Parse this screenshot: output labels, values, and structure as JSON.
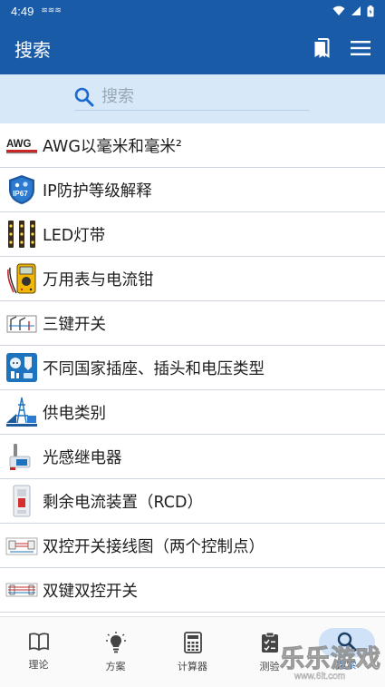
{
  "status_bar": {
    "time": "4:49",
    "notification": "≋≋≋"
  },
  "app_bar": {
    "title": "搜索",
    "bookmark_icon": "bookmark-icon",
    "menu_icon": "menu-icon"
  },
  "search": {
    "placeholder": "搜索",
    "value": "",
    "icon": "search-icon"
  },
  "list": {
    "items": [
      {
        "label": "AWG以毫米和毫米²",
        "icon": "awg-cable-icon"
      },
      {
        "label": "IP防护等级解释",
        "icon": "ip67-shield-icon"
      },
      {
        "label": "LED灯带",
        "icon": "led-strip-icon"
      },
      {
        "label": "万用表与电流钳",
        "icon": "multimeter-icon"
      },
      {
        "label": "三键开关",
        "icon": "three-way-switch-icon"
      },
      {
        "label": "不同国家插座、插头和电压类型",
        "icon": "plug-socket-icon"
      },
      {
        "label": "供电类别",
        "icon": "power-supply-icon"
      },
      {
        "label": "光感继电器",
        "icon": "light-sensor-relay-icon"
      },
      {
        "label": "剩余电流装置（RCD）",
        "icon": "rcd-device-icon"
      },
      {
        "label": "双控开关接线图（两个控制点）",
        "icon": "two-way-wiring-icon"
      },
      {
        "label": "双键双控开关",
        "icon": "double-switch-icon"
      }
    ]
  },
  "bottom_nav": {
    "items": [
      {
        "label": "理论",
        "icon": "book-icon"
      },
      {
        "label": "方案",
        "icon": "lightbulb-icon"
      },
      {
        "label": "计算器",
        "icon": "calculator-icon"
      },
      {
        "label": "测验",
        "icon": "clipboard-icon"
      },
      {
        "label": "搜索",
        "icon": "search-icon",
        "active": true
      }
    ]
  },
  "watermark": {
    "text": "乐乐游戏",
    "url": "www.6lt.com"
  },
  "colors": {
    "primary": "#1a5ba8",
    "search_band": "#d7e9f9",
    "active_pill": "#cfe2f7"
  }
}
